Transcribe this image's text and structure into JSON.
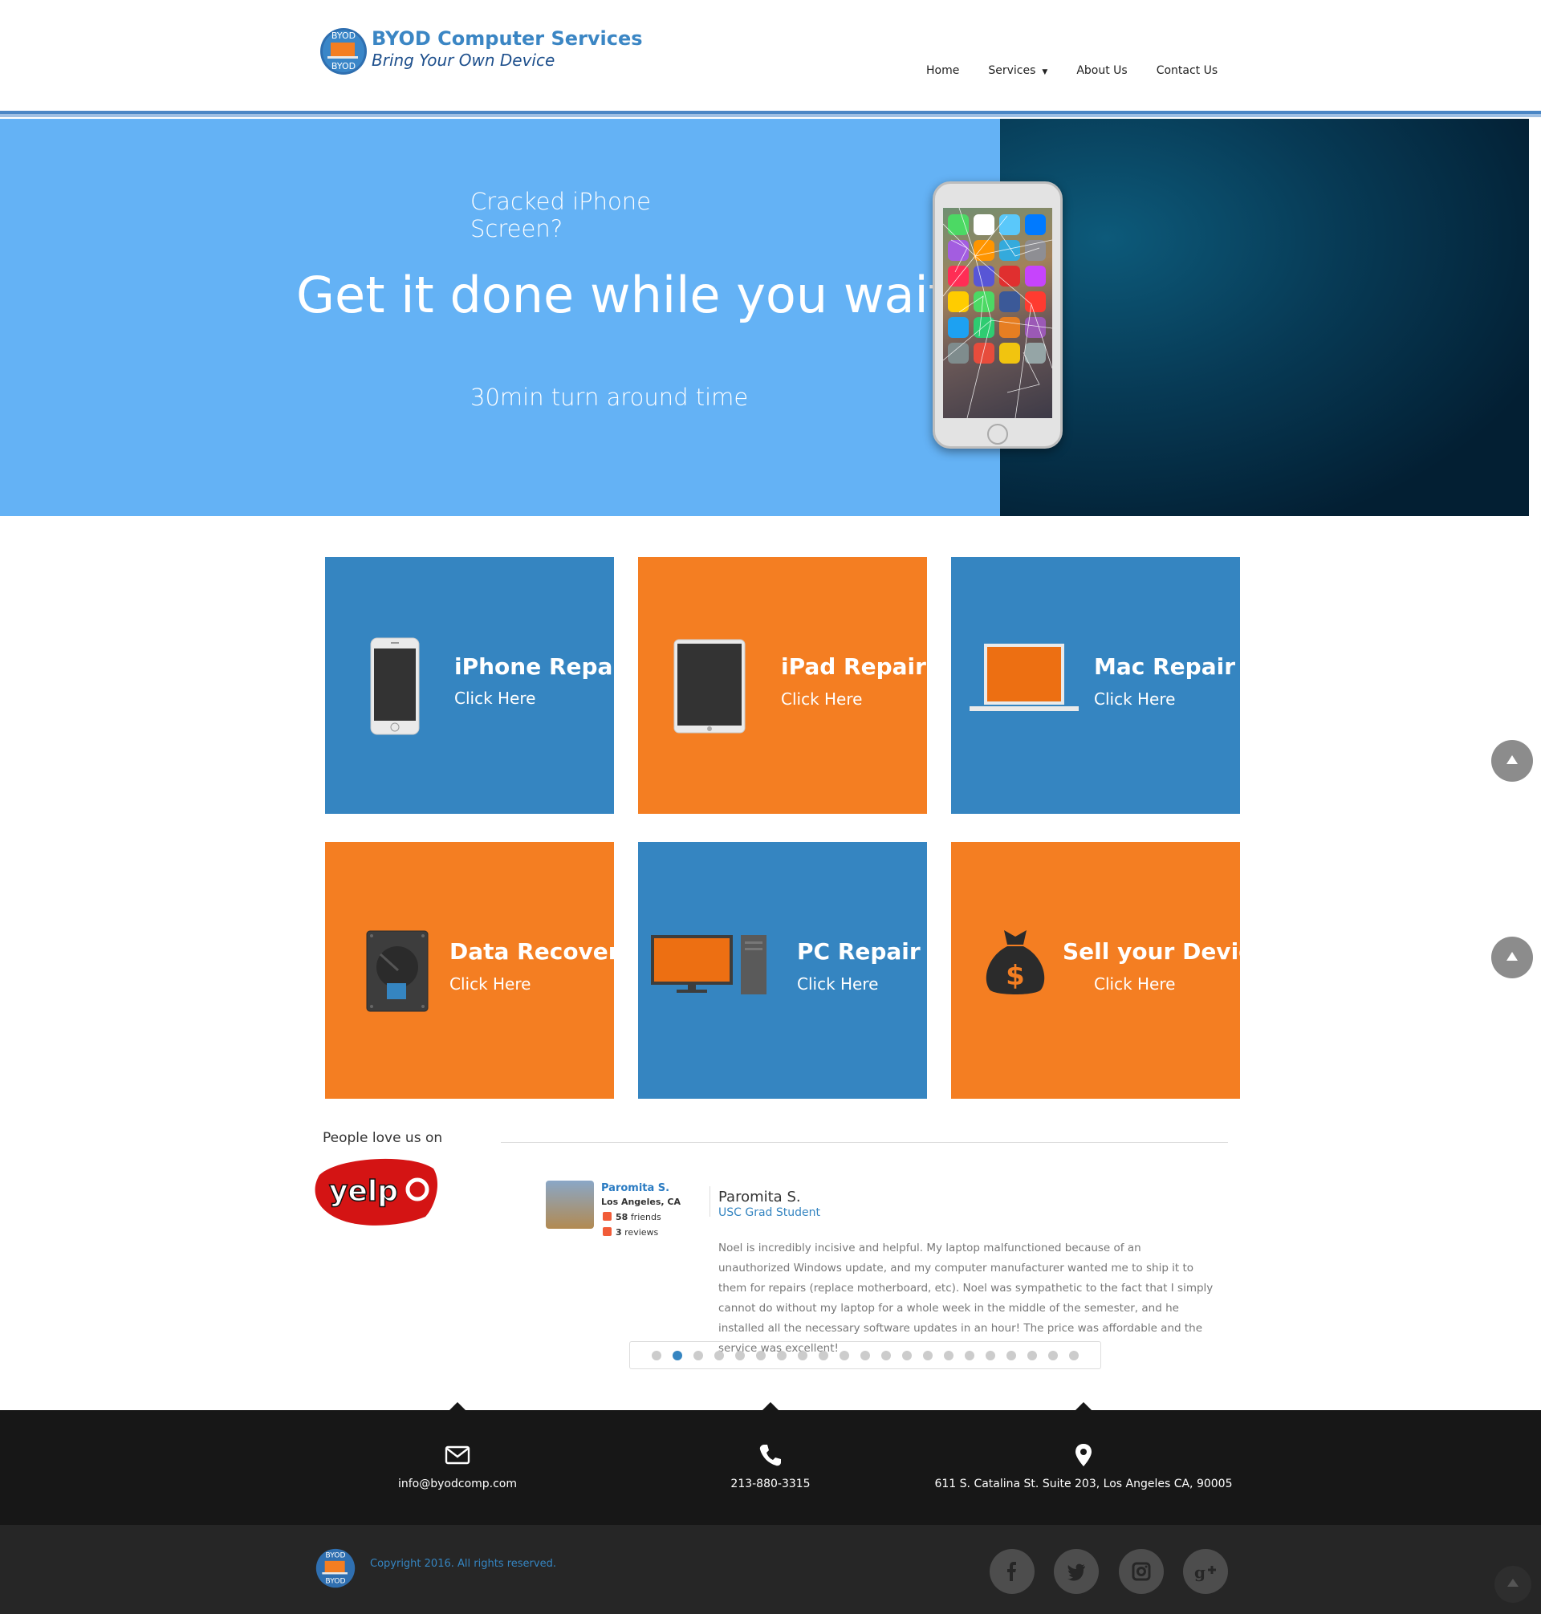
{
  "brand": {
    "name": "BYOD Computer Services",
    "tagline": "Bring Your Own Device",
    "logo_text": "BYOD"
  },
  "nav": {
    "items": [
      "Home",
      "Services",
      "About Us",
      "Contact Us"
    ],
    "services_has_dropdown": true
  },
  "hero": {
    "subtitle": "Cracked iPhone Screen?",
    "title": "Get it done while you wait!",
    "footer": "30min turn around time"
  },
  "tiles": [
    {
      "title": "iPhone Repair",
      "link": "Click Here",
      "color": "#3585c1",
      "icon": "iphone-icon"
    },
    {
      "title": "iPad Repair",
      "link": "Click Here",
      "color": "#f47e22",
      "icon": "ipad-icon"
    },
    {
      "title": "Mac Repair",
      "link": "Click Here",
      "color": "#3585c1",
      "icon": "laptop-icon"
    },
    {
      "title": "Data Recovery",
      "link": "Click Here",
      "color": "#f47e22",
      "icon": "hard-drive-icon"
    },
    {
      "title": "PC Repair",
      "link": "Click Here",
      "color": "#3585c1",
      "icon": "desktop-pc-icon"
    },
    {
      "title": "Sell your Device",
      "link": "Click Here",
      "color": "#f47e22",
      "icon": "money-bag-icon"
    }
  ],
  "yelp": {
    "heading": "People love us on",
    "logo_text": "yelp"
  },
  "review": {
    "card_name": "Paromita S.",
    "card_city": "Los Angeles, CA",
    "friends_count": "58",
    "friends_label": "friends",
    "reviews_count": "3",
    "reviews_label": "reviews",
    "name": "Paromita S.",
    "role": "USC Grad Student",
    "text": "Noel is incredibly incisive and helpful. My laptop malfunctioned because of an unauthorized Windows update, and my computer manufacturer wanted me to ship it to them for repairs (replace motherboard, etc). Noel was sympathetic to the fact that I simply cannot do without my laptop for a whole week in the middle of the semester, and he installed all the necessary software updates in an hour! The price was affordable and the service was excellent!",
    "slide_count": 21,
    "active_slide": 2
  },
  "contact": {
    "email": "info@byodcomp.com",
    "phone": "213-880-3315",
    "address": "611 S. Catalina St. Suite 203, Los Angeles CA, 90005"
  },
  "footer": {
    "copyright": "Copyright 2016. All rights reserved.",
    "social": [
      "facebook-icon",
      "twitter-icon",
      "instagram-icon",
      "google-plus-icon"
    ]
  },
  "colors": {
    "blue": "#3585c1",
    "orange": "#f47e22",
    "hero_blue": "#64b2f5",
    "dark": "#171717"
  }
}
